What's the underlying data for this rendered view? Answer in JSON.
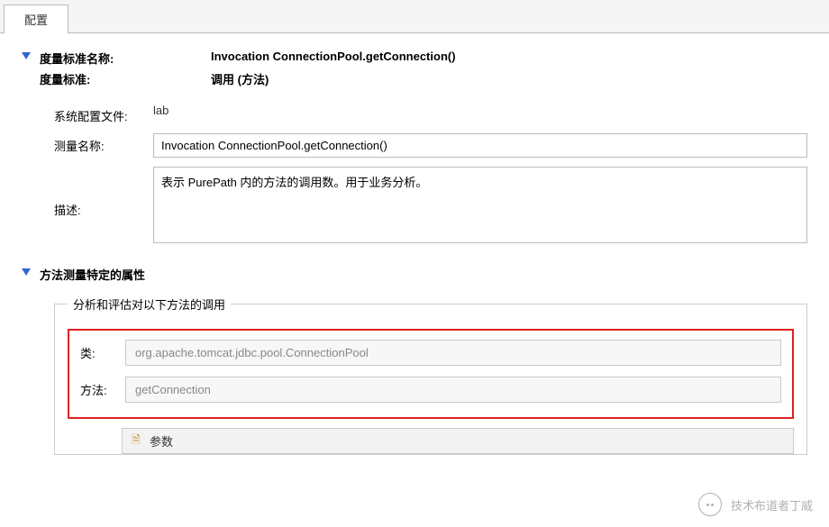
{
  "tab": {
    "label": "配置"
  },
  "header": {
    "metric_name_label": "度量标准名称:",
    "metric_name_value": "Invocation ConnectionPool.getConnection()",
    "metric_label": "度量标准:",
    "metric_value": "调用 (方法)"
  },
  "form": {
    "system_profile_label": "系统配置文件:",
    "system_profile_value": "lab",
    "measure_name_label": "测量名称:",
    "measure_name_value": "Invocation ConnectionPool.getConnection()",
    "description_label": "描述:",
    "description_value": "表示 PurePath 内的方法的调用数。用于业务分析。"
  },
  "section2": {
    "title": "方法测量特定的属性",
    "fieldset_legend": "分析和评估对以下方法的调用",
    "class_label": "类:",
    "class_value": "org.apache.tomcat.jdbc.pool.ConnectionPool",
    "method_label": "方法:",
    "method_value": "getConnection",
    "table_column": "参数"
  },
  "watermark": {
    "text": "技术布道者丁威"
  }
}
